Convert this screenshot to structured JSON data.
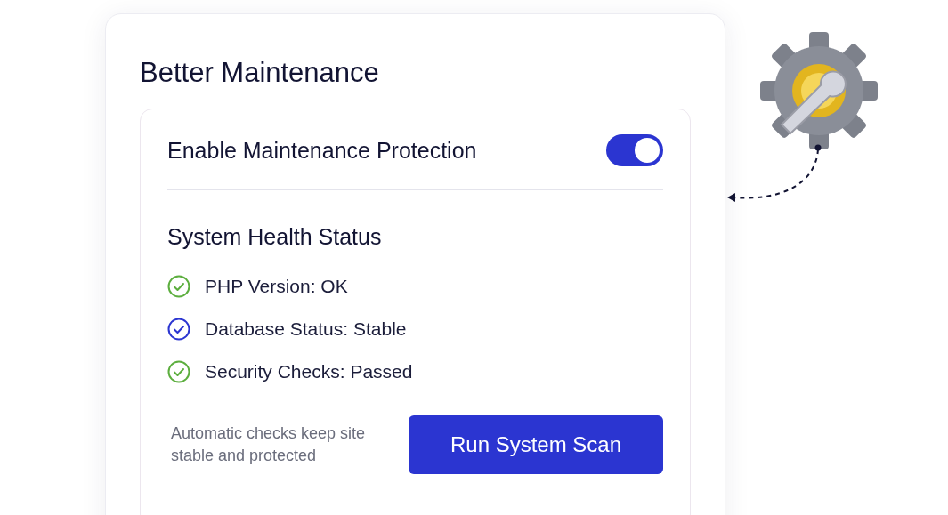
{
  "card": {
    "title": "Better Maintenance"
  },
  "protection": {
    "label": "Enable Maintenance Protection",
    "on": true
  },
  "health": {
    "heading": "System Health Status",
    "checks": [
      {
        "label": "PHP Version: OK",
        "color": "#5cae3e"
      },
      {
        "label": "Database Status: Stable",
        "color": "#2b35d1"
      },
      {
        "label": "Security Checks: Passed",
        "color": "#5cae3e"
      }
    ]
  },
  "footer": {
    "note": "Automatic checks keep site stable and protected",
    "button": "Run System Scan"
  }
}
